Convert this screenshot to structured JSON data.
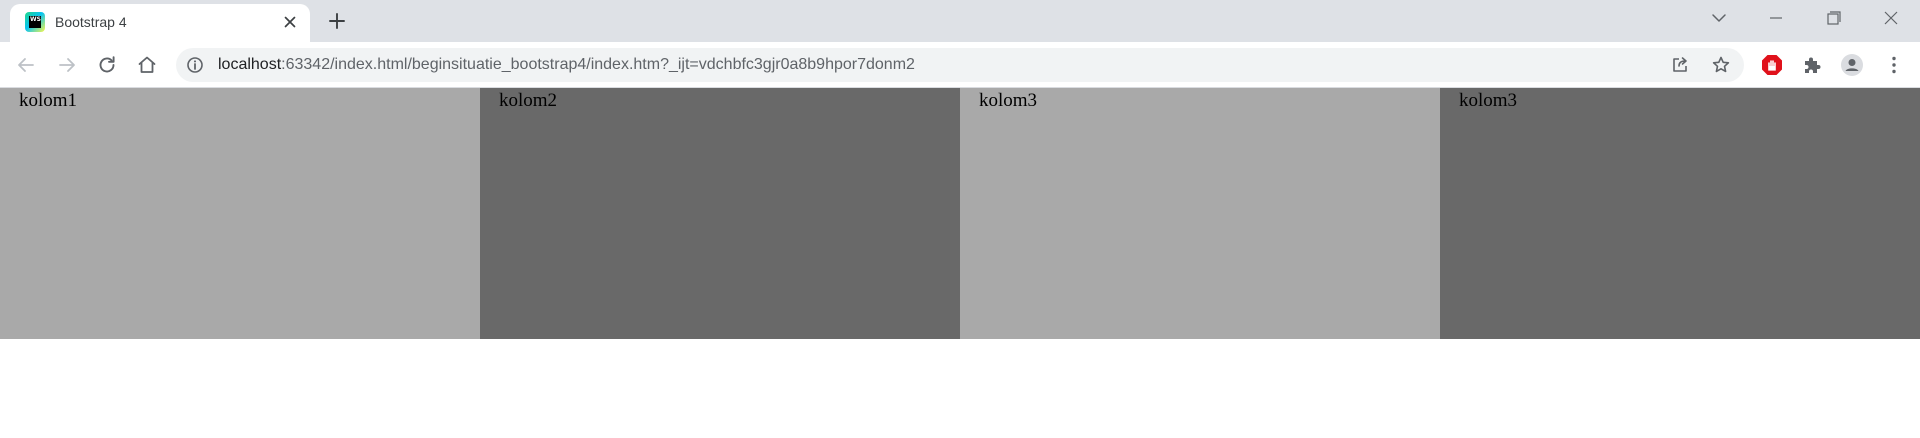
{
  "browser": {
    "tab": {
      "title": "Bootstrap 4",
      "favicon_icon": "webstorm-icon",
      "favicon_text": "WS"
    },
    "toolbar": {
      "url_host": "localhost",
      "url_path": ":63342/index.html/beginsituatie_bootstrap4/index.htm?_ijt=vdchbfc3gjr0a8b9hpor7donm2"
    },
    "colors": {
      "tabstrip_bg": "#dee1e6",
      "omnibox_bg": "#f1f3f4",
      "adblock_red": "#e0111b"
    }
  },
  "page": {
    "columns": [
      {
        "label": "kolom1",
        "shade": "light",
        "color": "#a9a9a9"
      },
      {
        "label": "kolom2",
        "shade": "dark",
        "color": "#696969"
      },
      {
        "label": "kolom3",
        "shade": "light",
        "color": "#a9a9a9"
      },
      {
        "label": "kolom3",
        "shade": "dark",
        "color": "#696969"
      }
    ]
  }
}
